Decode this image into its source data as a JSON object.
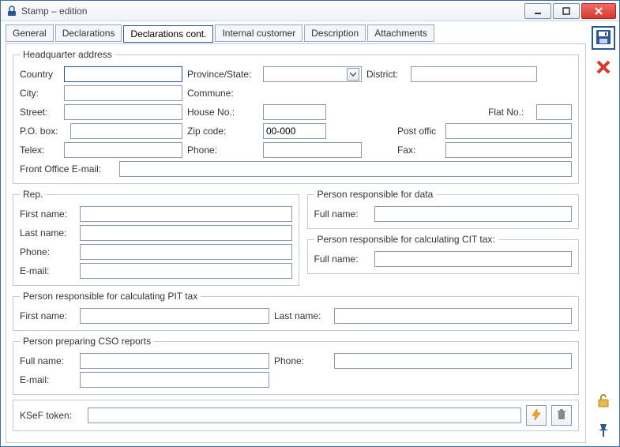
{
  "window": {
    "title": "Stamp – edition"
  },
  "tabs": [
    {
      "label": "General"
    },
    {
      "label": "Declarations"
    },
    {
      "label": "Declarations cont."
    },
    {
      "label": "Internal customer"
    },
    {
      "label": "Description"
    },
    {
      "label": "Attachments"
    }
  ],
  "hq": {
    "legend": "Headquarter address",
    "country_lab": "Country",
    "country_val": "",
    "province_lab": "Province/State:",
    "province_val": "",
    "district_lab": "District:",
    "district_val": "",
    "city_lab": "City:",
    "city_val": "",
    "commune_lab": "Commune:",
    "commune_val": "",
    "street_lab": "Street:",
    "street_val": "",
    "houseno_lab": "House No.:",
    "houseno_val": "",
    "flatno_lab": "Flat No.:",
    "flatno_val": "",
    "pobox_lab": "P.O. box:",
    "pobox_val": "",
    "zip_lab": "Zip code:",
    "zip_val": "00-000",
    "postoffice_lab": "Post offic",
    "postoffice_val": "",
    "telex_lab": "Telex:",
    "telex_val": "",
    "phone_lab": "Phone:",
    "phone_val": "",
    "fax_lab": "Fax:",
    "fax_val": "",
    "fo_email_lab": "Front Office E-mail:",
    "fo_email_val": ""
  },
  "rep": {
    "legend": "Rep.",
    "first_lab": "First name:",
    "first_val": "",
    "last_lab": "Last name:",
    "last_val": "",
    "phone_lab": "Phone:",
    "phone_val": "",
    "email_lab": "E-mail:",
    "email_val": ""
  },
  "prd": {
    "legend": "Person responsible for data",
    "full_lab": "Full name:",
    "full_val": ""
  },
  "prcit": {
    "legend": "Person responsible for calculating CIT tax:",
    "full_lab": "Full name:",
    "full_val": ""
  },
  "prpit": {
    "legend": "Person responsible for calculating PIT tax",
    "first_lab": "First name:",
    "first_val": "",
    "last_lab": "Last name:",
    "last_val": ""
  },
  "cso": {
    "legend": "Person preparing CSO reports",
    "full_lab": "Full name:",
    "full_val": "",
    "phone_lab": "Phone:",
    "phone_val": "",
    "email_lab": "E-mail:",
    "email_val": ""
  },
  "ksef": {
    "label": "KSeF token:",
    "value": ""
  }
}
